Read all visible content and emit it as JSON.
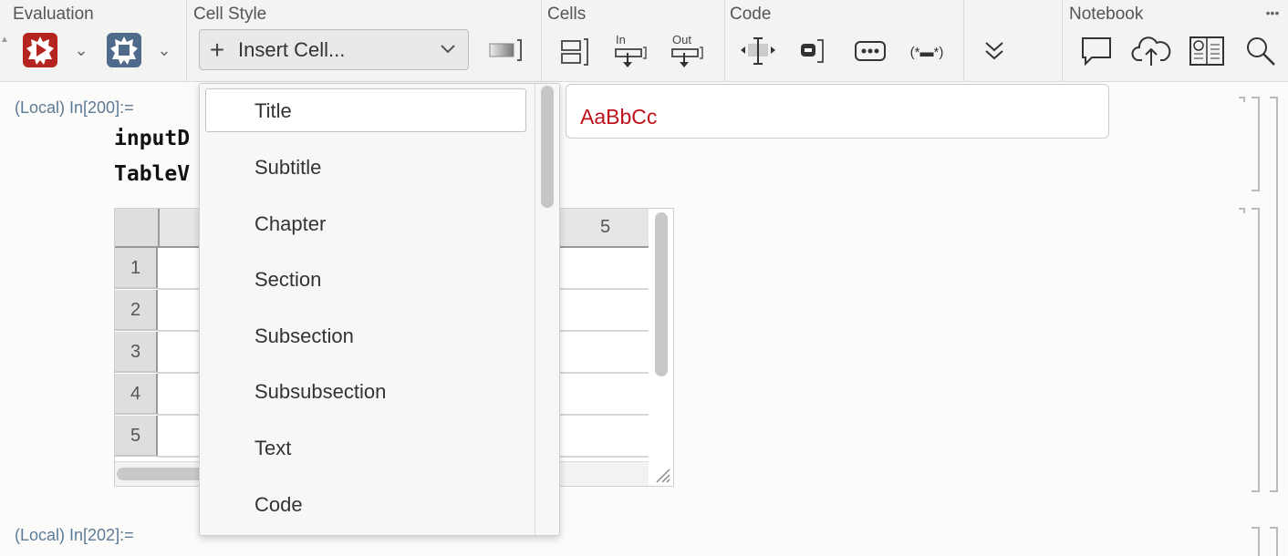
{
  "toolbar": {
    "groups": {
      "evaluation": "Evaluation",
      "cell_style": "Cell Style",
      "cells": "Cells",
      "code": "Code",
      "notebook": "Notebook"
    },
    "insert_cell_label": "Insert Cell...",
    "in_label": "In",
    "out_label": "Out",
    "code_tag": "(*▬*)",
    "more_label": "•••",
    "icons": {
      "evaluate": "evaluate-notebook-icon",
      "abort": "abort-evaluation-icon",
      "style_preview": "style-gradient-icon",
      "cells_group": "group-cells-icon",
      "in_cell": "insert-input-icon",
      "out_cell": "insert-output-icon",
      "split": "split-cell-icon",
      "code_cell": "code-cell-icon",
      "ellipsis": "ellipsis-icon",
      "expand": "double-chevron-down-icon",
      "chat": "chat-icon",
      "cloud": "cloud-upload-icon",
      "publish": "publish-notebook-icon",
      "search": "search-icon"
    },
    "accent_red": "#b5251f",
    "accent_blue": "#4f6a8a"
  },
  "notebook": {
    "cell1_label": "(Local) In[200]:=",
    "cell1_line1": "inputD",
    "cell1_line2": "TableV",
    "cell2_label": "(Local) In[202]:=",
    "table": {
      "column_header": "5",
      "row_headers": [
        "1",
        "2",
        "3",
        "4",
        "5"
      ]
    }
  },
  "style_preview": {
    "text": "AaBbCc",
    "color": "#c0121b"
  },
  "menu": {
    "items": [
      "Title",
      "Subtitle",
      "Chapter",
      "Section",
      "Subsection",
      "Subsubsection",
      "Text",
      "Code"
    ],
    "selected": "Title"
  }
}
